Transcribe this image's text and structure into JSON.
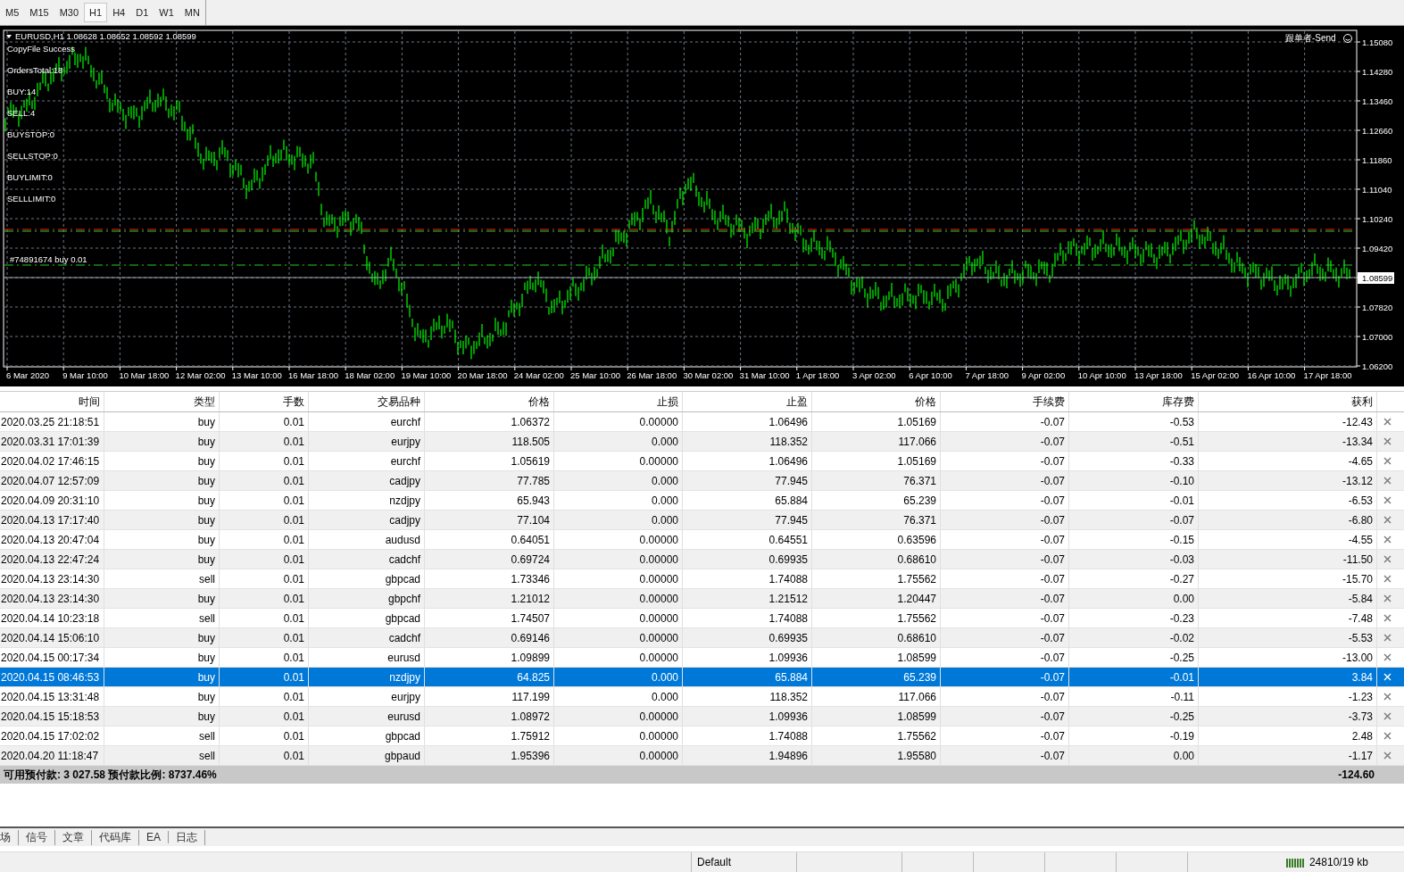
{
  "timeframes": [
    {
      "label": "M5",
      "selected": false
    },
    {
      "label": "M15",
      "selected": false
    },
    {
      "label": "M30",
      "selected": false
    },
    {
      "label": "H1",
      "selected": true
    },
    {
      "label": "H4",
      "selected": false
    },
    {
      "label": "D1",
      "selected": false
    },
    {
      "label": "W1",
      "selected": false
    },
    {
      "label": "MN",
      "selected": false
    }
  ],
  "chart": {
    "header": "EURUSD,H1  1.08628 1.08652 1.08592 1.08599",
    "info_lines": [
      "CopyFile Success",
      "OrdersTotal:18",
      "BUY:14",
      "SELL:4",
      "BUYSTOP:0",
      "SELLSTOP:0",
      "BUYLIMIT:0",
      "SELLLIMIT:0"
    ],
    "indicator_label": "跟单者-Send",
    "order_label": "#74891674 buy 0.01",
    "price_ticks": [
      "1.15080",
      "1.14280",
      "1.13460",
      "1.12660",
      "1.11860",
      "1.11040",
      "1.10240",
      "1.09420",
      "1.08599",
      "1.07820",
      "1.07000",
      "1.06200"
    ],
    "time_ticks": [
      "6 Mar 2020",
      "9 Mar 10:00",
      "10 Mar 18:00",
      "12 Mar 02:00",
      "13 Mar 10:00",
      "16 Mar 18:00",
      "18 Mar 02:00",
      "19 Mar 10:00",
      "20 Mar 18:00",
      "24 Mar 02:00",
      "25 Mar 10:00",
      "26 Mar 18:00",
      "30 Mar 02:00",
      "31 Mar 10:00",
      "1 Apr 18:00",
      "3 Apr 02:00",
      "6 Apr 10:00",
      "7 Apr 18:00",
      "9 Apr 02:00",
      "10 Apr 10:00",
      "13 Apr 18:00",
      "15 Apr 02:00",
      "16 Apr 10:00",
      "17 Apr 18:00"
    ]
  },
  "table": {
    "columns": [
      "时间",
      "类型",
      "手数",
      "交易品种",
      "价格",
      "止损",
      "止盈",
      "价格",
      "手续费",
      "库存费",
      "获利"
    ],
    "rows": [
      {
        "selected": false,
        "cells": [
          "2020.03.25 21:18:51",
          "buy",
          "0.01",
          "eurchf",
          "1.06372",
          "0.00000",
          "1.06496",
          "1.05169",
          "-0.07",
          "-0.53",
          "-12.43"
        ]
      },
      {
        "selected": false,
        "cells": [
          "2020.03.31 17:01:39",
          "buy",
          "0.01",
          "eurjpy",
          "118.505",
          "0.000",
          "118.352",
          "117.066",
          "-0.07",
          "-0.51",
          "-13.34"
        ]
      },
      {
        "selected": false,
        "cells": [
          "2020.04.02 17:46:15",
          "buy",
          "0.01",
          "eurchf",
          "1.05619",
          "0.00000",
          "1.06496",
          "1.05169",
          "-0.07",
          "-0.33",
          "-4.65"
        ]
      },
      {
        "selected": false,
        "cells": [
          "2020.04.07 12:57:09",
          "buy",
          "0.01",
          "cadjpy",
          "77.785",
          "0.000",
          "77.945",
          "76.371",
          "-0.07",
          "-0.10",
          "-13.12"
        ]
      },
      {
        "selected": false,
        "cells": [
          "2020.04.09 20:31:10",
          "buy",
          "0.01",
          "nzdjpy",
          "65.943",
          "0.000",
          "65.884",
          "65.239",
          "-0.07",
          "-0.01",
          "-6.53"
        ]
      },
      {
        "selected": false,
        "cells": [
          "2020.04.13 17:17:40",
          "buy",
          "0.01",
          "cadjpy",
          "77.104",
          "0.000",
          "77.945",
          "76.371",
          "-0.07",
          "-0.07",
          "-6.80"
        ]
      },
      {
        "selected": false,
        "cells": [
          "2020.04.13 20:47:04",
          "buy",
          "0.01",
          "audusd",
          "0.64051",
          "0.00000",
          "0.64551",
          "0.63596",
          "-0.07",
          "-0.15",
          "-4.55"
        ]
      },
      {
        "selected": false,
        "cells": [
          "2020.04.13 22:47:24",
          "buy",
          "0.01",
          "cadchf",
          "0.69724",
          "0.00000",
          "0.69935",
          "0.68610",
          "-0.07",
          "-0.03",
          "-11.50"
        ]
      },
      {
        "selected": false,
        "cells": [
          "2020.04.13 23:14:30",
          "sell",
          "0.01",
          "gbpcad",
          "1.73346",
          "0.00000",
          "1.74088",
          "1.75562",
          "-0.07",
          "-0.27",
          "-15.70"
        ]
      },
      {
        "selected": false,
        "cells": [
          "2020.04.13 23:14:30",
          "buy",
          "0.01",
          "gbpchf",
          "1.21012",
          "0.00000",
          "1.21512",
          "1.20447",
          "-0.07",
          "0.00",
          "-5.84"
        ]
      },
      {
        "selected": false,
        "cells": [
          "2020.04.14 10:23:18",
          "sell",
          "0.01",
          "gbpcad",
          "1.74507",
          "0.00000",
          "1.74088",
          "1.75562",
          "-0.07",
          "-0.23",
          "-7.48"
        ]
      },
      {
        "selected": false,
        "cells": [
          "2020.04.14 15:06:10",
          "buy",
          "0.01",
          "cadchf",
          "0.69146",
          "0.00000",
          "0.69935",
          "0.68610",
          "-0.07",
          "-0.02",
          "-5.53"
        ]
      },
      {
        "selected": false,
        "cells": [
          "2020.04.15 00:17:34",
          "buy",
          "0.01",
          "eurusd",
          "1.09899",
          "0.00000",
          "1.09936",
          "1.08599",
          "-0.07",
          "-0.25",
          "-13.00"
        ]
      },
      {
        "selected": true,
        "cells": [
          "2020.04.15 08:46:53",
          "buy",
          "0.01",
          "nzdjpy",
          "64.825",
          "0.000",
          "65.884",
          "65.239",
          "-0.07",
          "-0.01",
          "3.84"
        ]
      },
      {
        "selected": false,
        "cells": [
          "2020.04.15 13:31:48",
          "buy",
          "0.01",
          "eurjpy",
          "117.199",
          "0.000",
          "118.352",
          "117.066",
          "-0.07",
          "-0.11",
          "-1.23"
        ]
      },
      {
        "selected": false,
        "cells": [
          "2020.04.15 15:18:53",
          "buy",
          "0.01",
          "eurusd",
          "1.08972",
          "0.00000",
          "1.09936",
          "1.08599",
          "-0.07",
          "-0.25",
          "-3.73"
        ]
      },
      {
        "selected": false,
        "cells": [
          "2020.04.15 17:02:02",
          "sell",
          "0.01",
          "gbpcad",
          "1.75912",
          "0.00000",
          "1.74088",
          "1.75562",
          "-0.07",
          "-0.19",
          "2.48"
        ]
      },
      {
        "selected": false,
        "cells": [
          "2020.04.20 11:18:47",
          "sell",
          "0.01",
          "gbpaud",
          "1.95396",
          "0.00000",
          "1.94896",
          "1.95580",
          "-0.07",
          "0.00",
          "-1.17"
        ]
      }
    ],
    "summary": {
      "text": "可用预付款: 3 027.58  预付款比例: 8737.46%",
      "total": "-124.60"
    }
  },
  "bottom_tabs": [
    "场",
    "信号",
    "文章",
    "代码库",
    "EA",
    "日志"
  ],
  "status_bar": {
    "profile": "Default",
    "traffic": "24810/19 kb"
  }
}
